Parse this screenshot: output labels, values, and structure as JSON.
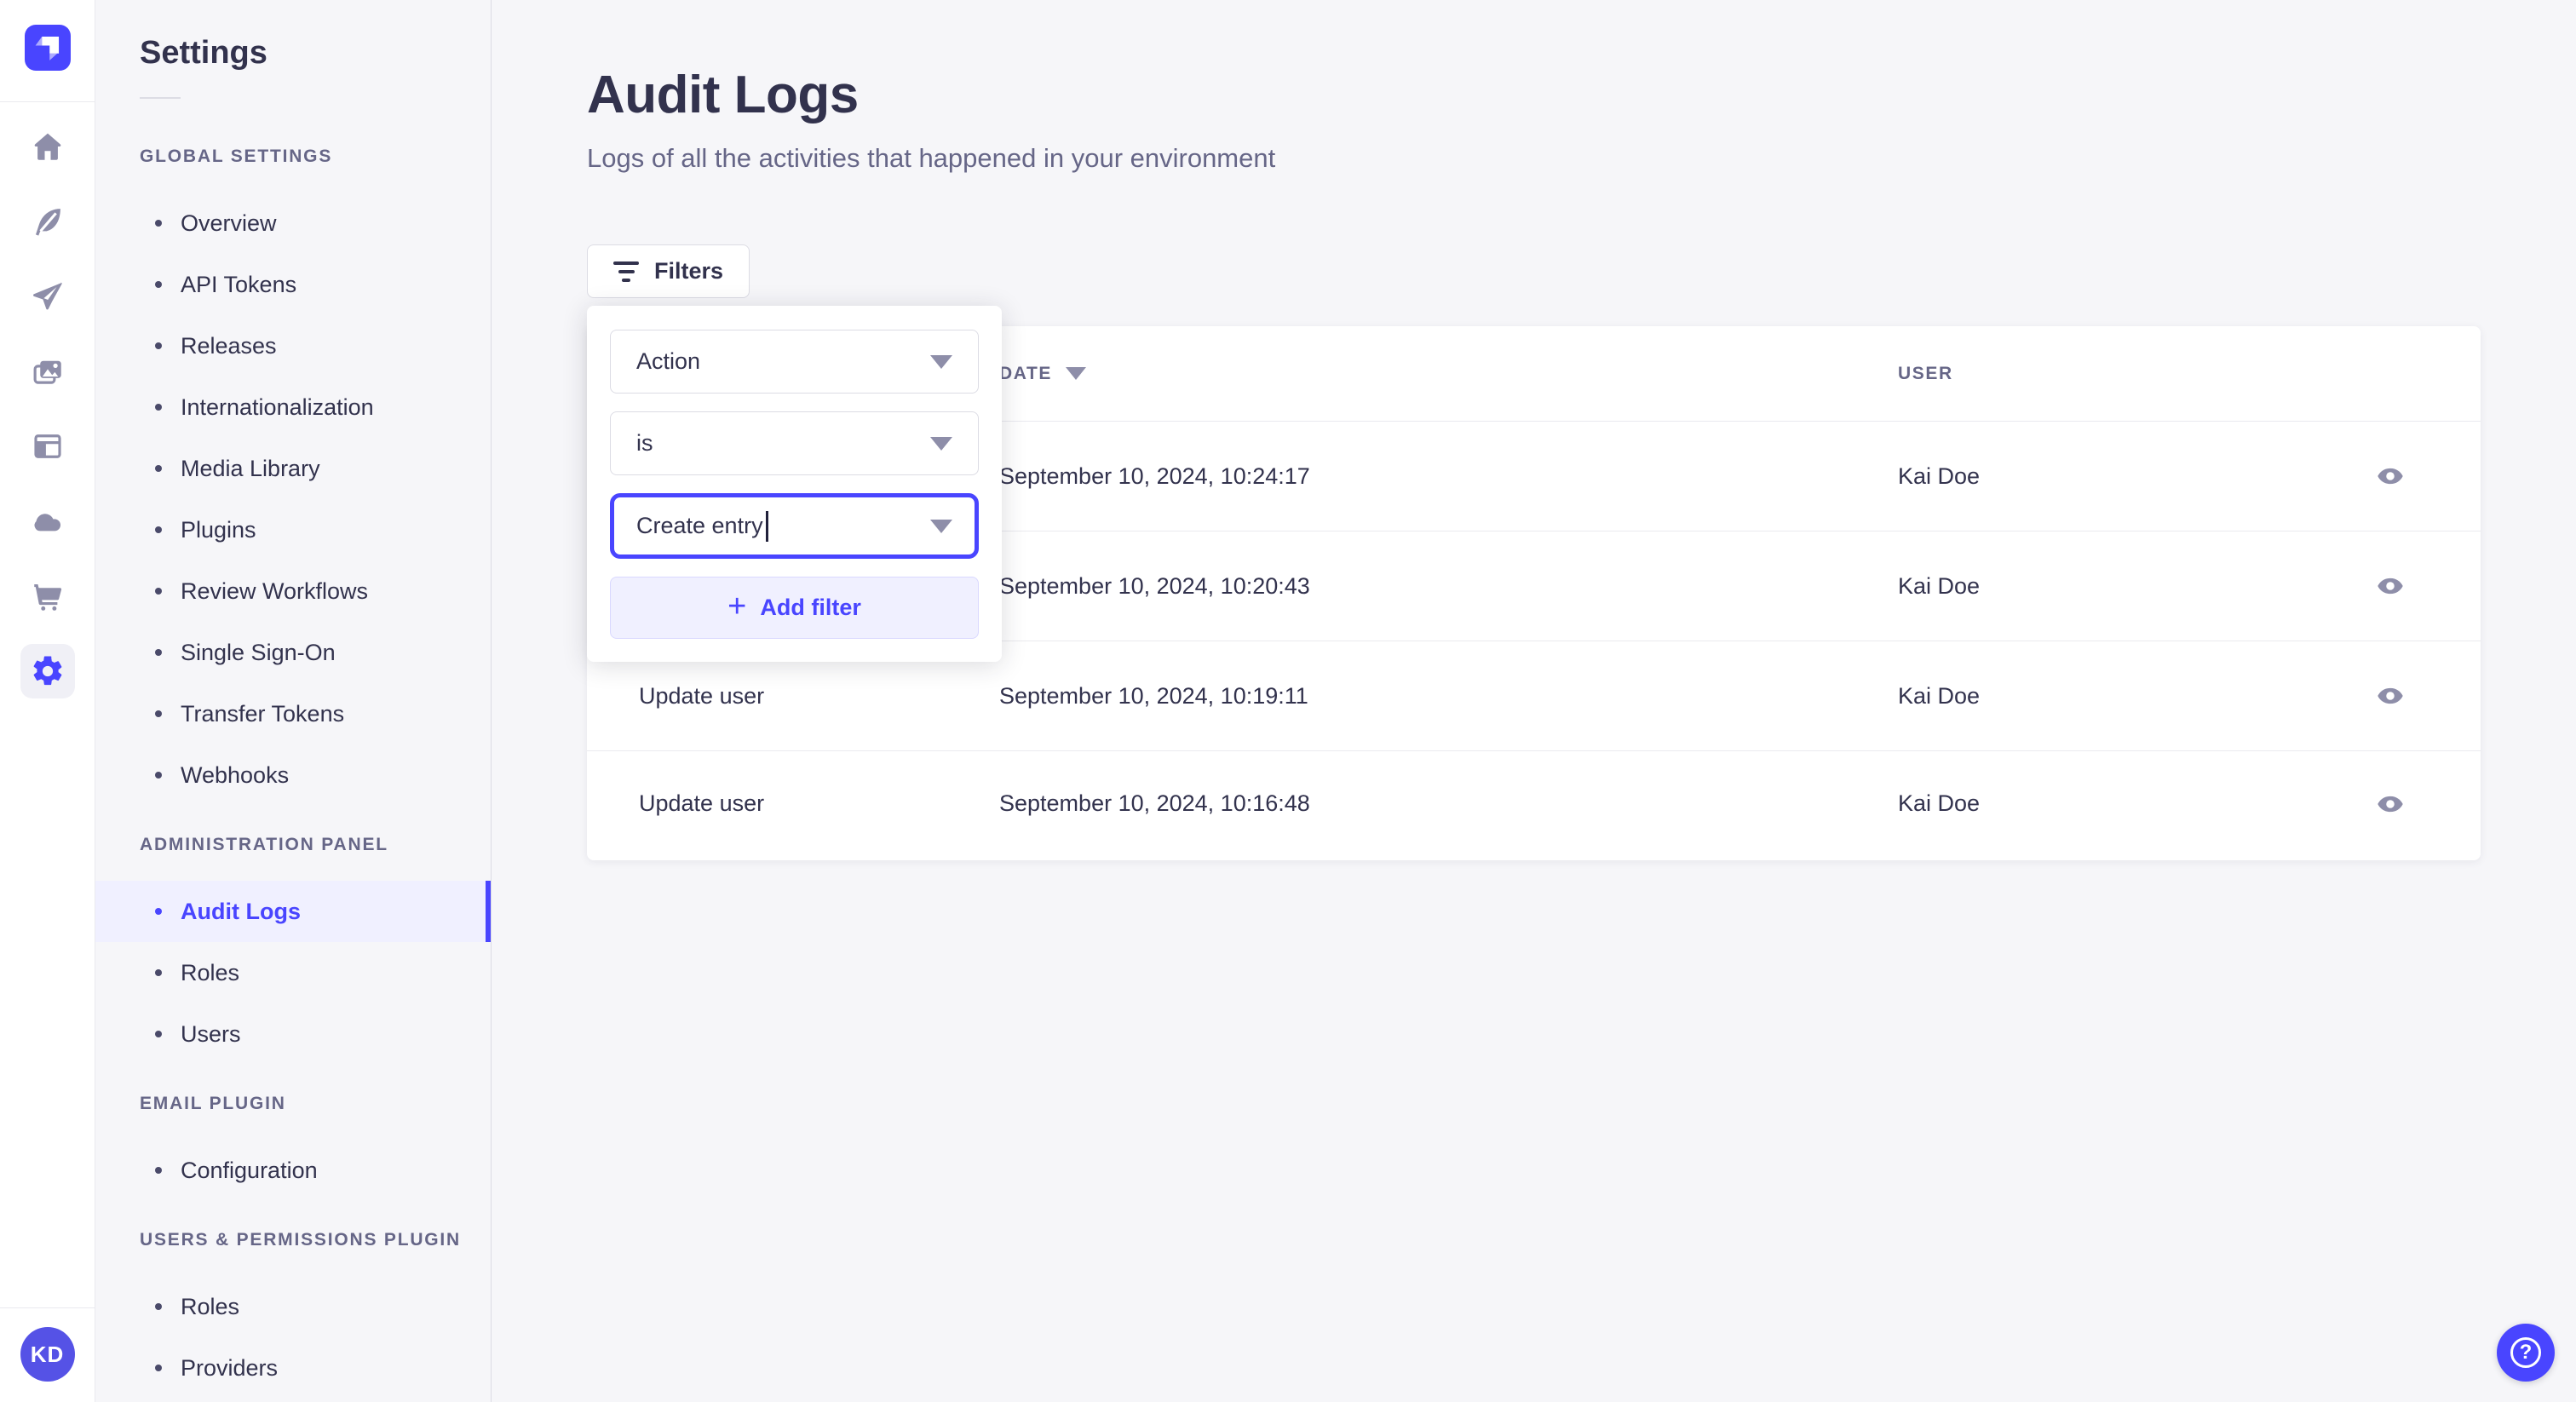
{
  "colors": {
    "primary": "#4945FF",
    "primary_light_bg": "#F0F0FF",
    "text_dark": "#32324D",
    "text_muted": "#666687",
    "icon_gray": "#8E8EA9",
    "border": "#DCDCE4",
    "divider": "#EAEAEF",
    "app_bg": "#F6F6F9",
    "avatar_bg": "#5552E6"
  },
  "rail": {
    "logo": "strapi-logo",
    "icons": [
      "home-icon",
      "feather-icon",
      "send-icon",
      "media-library-icon",
      "layout-icon",
      "cloud-icon",
      "cart-icon",
      "settings-gear-icon"
    ],
    "active_icon": "settings-gear-icon"
  },
  "user": {
    "initials": "KD"
  },
  "sidebar": {
    "title": "Settings",
    "sections": [
      {
        "label": "GLOBAL SETTINGS",
        "items": [
          "Overview",
          "API Tokens",
          "Releases",
          "Internationalization",
          "Media Library",
          "Plugins",
          "Review Workflows",
          "Single Sign-On",
          "Transfer Tokens",
          "Webhooks"
        ]
      },
      {
        "label": "ADMINISTRATION PANEL",
        "items": [
          "Audit Logs",
          "Roles",
          "Users"
        ],
        "active_item": "Audit Logs"
      },
      {
        "label": "EMAIL PLUGIN",
        "items": [
          "Configuration"
        ]
      },
      {
        "label": "USERS & PERMISSIONS PLUGIN",
        "items": [
          "Roles",
          "Providers"
        ]
      }
    ]
  },
  "main": {
    "title": "Audit Logs",
    "subtitle": "Logs of all the activities that happened in your environment",
    "filters_label": "Filters"
  },
  "popover": {
    "field": "Action",
    "operator": "is",
    "value": "Create entry",
    "add_icon": "+",
    "add_filter_label": "Add filter"
  },
  "table": {
    "headers": {
      "date": "DATE",
      "user": "USER"
    },
    "rows": [
      {
        "action": "",
        "date": "September 10, 2024, 10:24:17",
        "user": "Kai Doe"
      },
      {
        "action": "",
        "date": "September 10, 2024, 10:20:43",
        "user": "Kai Doe"
      },
      {
        "action": "Update user",
        "date": "September 10, 2024, 10:19:11",
        "user": "Kai Doe"
      },
      {
        "action": "Update user",
        "date": "September 10, 2024, 10:16:48",
        "user": "Kai Doe"
      }
    ]
  },
  "help": {
    "icon": "?"
  }
}
